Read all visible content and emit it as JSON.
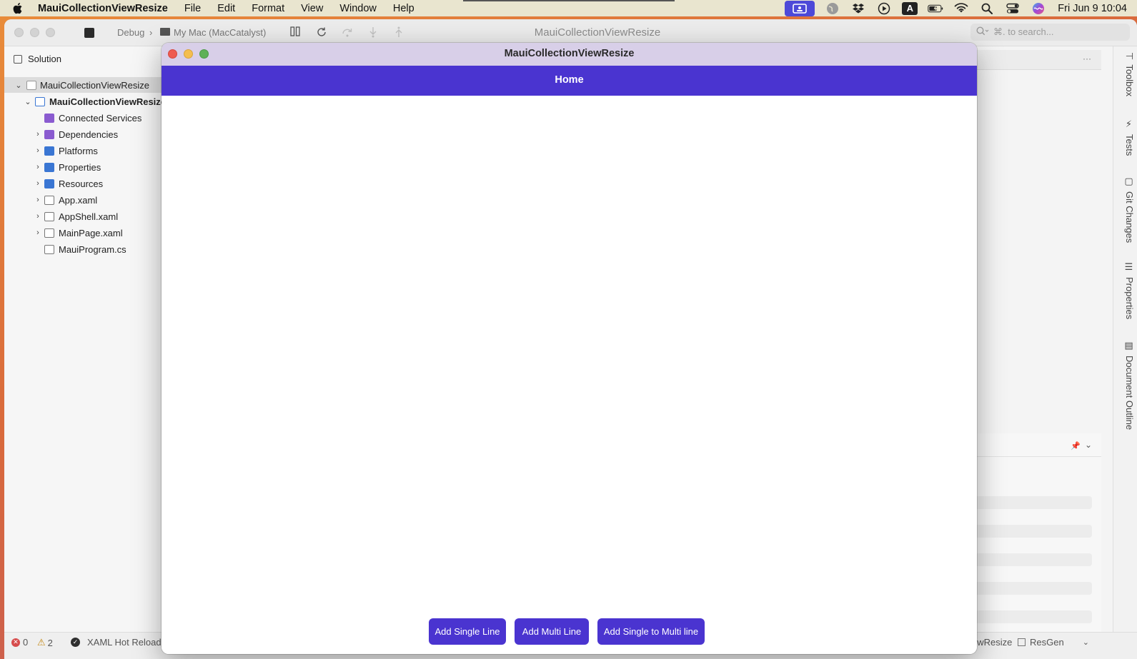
{
  "menubar": {
    "app_name": "MauiCollectionViewResize",
    "menus": [
      "File",
      "Edit",
      "Format",
      "View",
      "Window",
      "Help"
    ],
    "status_icons": [
      "screen-share-icon",
      "globe-icon",
      "dropbox-icon",
      "play-circle-icon",
      "keyboard-input-a-icon",
      "battery-charging-icon",
      "wifi-icon",
      "spotlight-search-icon",
      "control-center-icon",
      "siri-icon"
    ],
    "input_source": "A",
    "clock": "Fri Jun 9  10:04"
  },
  "ide": {
    "toolbar": {
      "configuration": "Debug",
      "separator": "›",
      "run_target": "My Mac (MacCatalyst)",
      "title": "MauiCollectionViewResize",
      "search_placeholder": "⌘. to search..."
    },
    "solution_pad": {
      "title": "Solution",
      "items": [
        {
          "label": "MauiCollectionViewResize",
          "icon": "solution-icon",
          "expanded": true
        },
        {
          "label": "MauiCollectionViewResize",
          "icon": "project-icon",
          "expanded": true
        },
        {
          "label": "Connected Services",
          "icon": "connected-services-icon"
        },
        {
          "label": "Dependencies",
          "icon": "dependencies-icon"
        },
        {
          "label": "Platforms",
          "icon": "folder-icon"
        },
        {
          "label": "Properties",
          "icon": "folder-icon"
        },
        {
          "label": "Resources",
          "icon": "folder-icon"
        },
        {
          "label": "App.xaml",
          "icon": "xaml-file-icon"
        },
        {
          "label": "AppShell.xaml",
          "icon": "xaml-file-icon"
        },
        {
          "label": "MainPage.xaml",
          "icon": "xaml-file-icon"
        },
        {
          "label": "MauiProgram.cs",
          "icon": "csharp-file-icon"
        }
      ]
    },
    "right_dock": {
      "tabs": [
        "Toolbox",
        "Tests",
        "Git Changes",
        "Properties",
        "Document Outline"
      ]
    },
    "editor_more": "···",
    "statusbar": {
      "errors": "0",
      "warnings": "2",
      "hot_reload": "XAML Hot Reload",
      "right_project": "ewResize",
      "resgen": "ResGen"
    }
  },
  "app": {
    "window_title": "MauiCollectionViewResize",
    "nav_title": "Home",
    "buttons": {
      "single": "Add Single Line",
      "multi": "Add Multi Line",
      "single_to_multi": "Add Single to Multi line"
    },
    "colors": {
      "primary": "#4a34d0",
      "titlebar": "#d8cfe8"
    }
  }
}
